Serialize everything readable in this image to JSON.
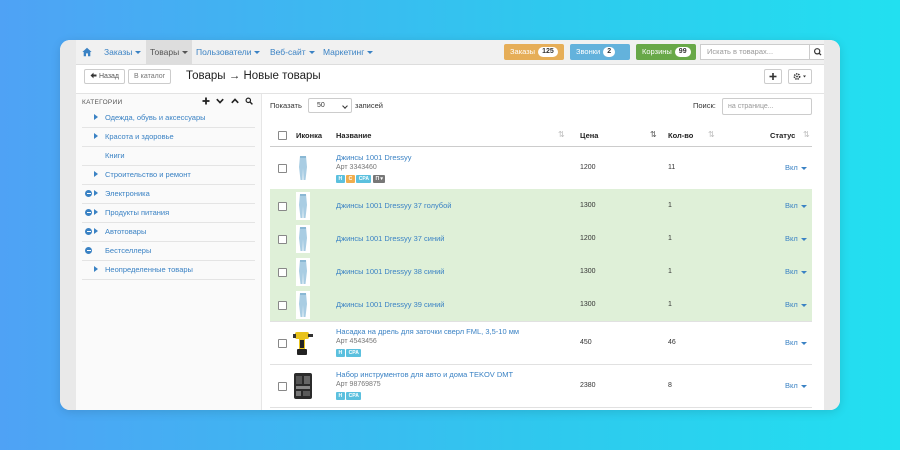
{
  "navbar": {
    "items": [
      {
        "label": "Заказы"
      },
      {
        "label": "Товары",
        "active": true
      },
      {
        "label": "Пользователи"
      },
      {
        "label": "Веб-сайт"
      },
      {
        "label": "Маркетинг"
      }
    ],
    "badges": [
      {
        "label": "Заказы",
        "count": "125",
        "color": "#e6ae58"
      },
      {
        "label": "Звонки",
        "count": "2",
        "color": "#63b2dc"
      },
      {
        "label": "Корзины",
        "count": "99",
        "color": "#68a848"
      }
    ],
    "search": {
      "placeholder": "Искать в товарах..."
    }
  },
  "header": {
    "back_label": "Назад",
    "catalog_label": "В каталог",
    "title": "Товары → Новые товары"
  },
  "sidebar": {
    "heading": "КАТЕГОРИИ",
    "items": [
      {
        "label": "Одежда, обувь и аксессуары",
        "expandable": true,
        "minus": false
      },
      {
        "label": "Красота и здоровье",
        "expandable": true,
        "minus": false
      },
      {
        "label": "Книги",
        "expandable": false,
        "minus": false
      },
      {
        "label": "Строительство и ремонт",
        "expandable": true,
        "minus": false
      },
      {
        "label": "Электроника",
        "expandable": true,
        "minus": true
      },
      {
        "label": "Продукты питания",
        "expandable": true,
        "minus": true
      },
      {
        "label": "Автотовары",
        "expandable": true,
        "minus": true
      },
      {
        "label": "Бестселлеры",
        "expandable": false,
        "minus": true
      },
      {
        "label": "Неопределенные товары",
        "expandable": true,
        "minus": false
      }
    ]
  },
  "table": {
    "show_label": "Показать",
    "page_size": "50",
    "records_label": "записей",
    "find_label": "Поиск:",
    "find_placeholder": "на странице...",
    "columns": {
      "icon": "Иконка",
      "name": "Название",
      "price": "Цена",
      "qty": "Кол-во",
      "status": "Статус"
    },
    "rows": [
      {
        "name": "Джинсы 1001 Dressyy",
        "sku": "Арт 3343460",
        "tags": [
          "Н",
          "С",
          "CPA",
          "П ▾"
        ],
        "price": "1200",
        "qty": "11",
        "status": "Вкл",
        "highlight": false,
        "thumb": "jeans"
      },
      {
        "name": "Джинсы 1001 Dressyy 37 голубой",
        "sku": "",
        "tags": [],
        "price": "1300",
        "qty": "1",
        "status": "Вкл",
        "highlight": true,
        "thumb": "jeans"
      },
      {
        "name": "Джинсы 1001 Dressyy 37 синий",
        "sku": "",
        "tags": [],
        "price": "1200",
        "qty": "1",
        "status": "Вкл",
        "highlight": true,
        "thumb": "jeans"
      },
      {
        "name": "Джинсы 1001 Dressyy 38 синий",
        "sku": "",
        "tags": [],
        "price": "1300",
        "qty": "1",
        "status": "Вкл",
        "highlight": true,
        "thumb": "jeans"
      },
      {
        "name": "Джинсы 1001 Dressyy 39 синий",
        "sku": "",
        "tags": [],
        "price": "1300",
        "qty": "1",
        "status": "Вкл",
        "highlight": true,
        "thumb": "jeans"
      },
      {
        "name": "Насадка на дрель для заточки сверл FML, 3,5-10 мм",
        "sku": "Арт 4543456",
        "tags": [
          "Н",
          "CPA"
        ],
        "price": "450",
        "qty": "46",
        "status": "Вкл",
        "highlight": false,
        "thumb": "drill"
      },
      {
        "name": "Набор инструментов для авто и дома TEKOV DMT",
        "sku": "Арт 98769875",
        "tags": [
          "Н",
          "CPA"
        ],
        "price": "2380",
        "qty": "8",
        "status": "Вкл",
        "highlight": false,
        "thumb": "toolkit"
      }
    ]
  }
}
